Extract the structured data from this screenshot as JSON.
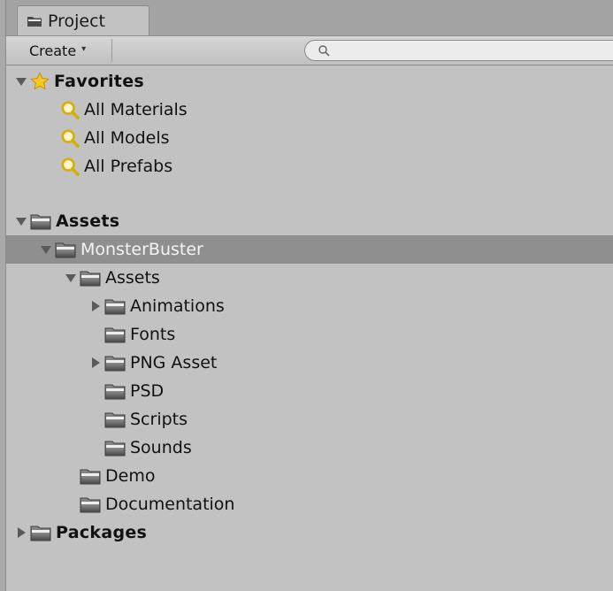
{
  "window": {
    "tab_label": "Project",
    "tab_icon": "folder-icon"
  },
  "toolbar": {
    "create_label": "Create",
    "create_caret": "▾",
    "search_value": "",
    "search_placeholder": ""
  },
  "tree": {
    "favorites": {
      "label": "Favorites",
      "icon": "star-icon",
      "expanded": true,
      "items": [
        {
          "label": "All Materials",
          "icon": "search-icon"
        },
        {
          "label": "All Models",
          "icon": "search-icon"
        },
        {
          "label": "All Prefabs",
          "icon": "search-icon"
        }
      ]
    },
    "assets": {
      "label": "Assets",
      "expanded": true,
      "monster": {
        "label": "MonsterBuster",
        "selected": true,
        "expanded": true,
        "assets": {
          "label": "Assets",
          "expanded": true,
          "children": [
            {
              "label": "Animations",
              "has_children": true
            },
            {
              "label": "Fonts",
              "has_children": false
            },
            {
              "label": "PNG Asset",
              "has_children": true
            },
            {
              "label": "PSD",
              "has_children": false
            },
            {
              "label": "Scripts",
              "has_children": false
            },
            {
              "label": "Sounds",
              "has_children": false
            }
          ]
        },
        "demo": {
          "label": "Demo"
        },
        "documentation": {
          "label": "Documentation"
        }
      }
    },
    "packages": {
      "label": "Packages",
      "expanded": false
    }
  },
  "colors": {
    "panel_bg": "#c2c2c2",
    "selected_row": "#8f8f8f",
    "selected_text": "#f4f4f4",
    "folder_fill": "#6b6b6b",
    "favorite_star": "#f4c21a",
    "search_lens": "#d8b420"
  }
}
